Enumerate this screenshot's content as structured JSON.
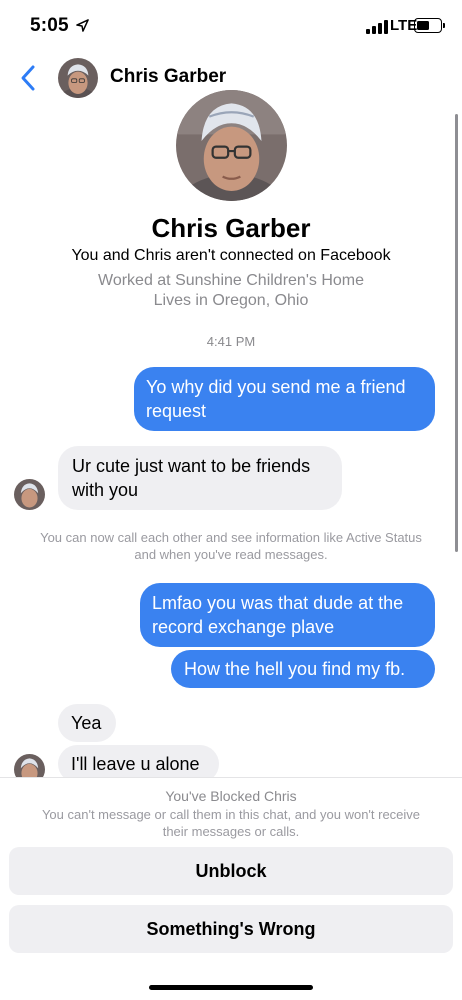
{
  "status_bar": {
    "time": "5:05",
    "network": "LTE",
    "battery_level": 0.55
  },
  "header": {
    "name": "Chris Garber"
  },
  "profile": {
    "name": "Chris Garber",
    "connection": "You and Chris aren't connected on Facebook",
    "work": "Worked at Sunshine Children's Home",
    "location": "Lives in Oregon, Ohio"
  },
  "conversation": {
    "timestamp": "4:41 PM",
    "messages": [
      {
        "direction": "outgoing",
        "text": "Yo why did you send me a friend request"
      },
      {
        "direction": "incoming",
        "text": "Ur cute just want to be friends with you"
      },
      {
        "direction": "outgoing",
        "text": "Lmfao you was that dude at the record exchange plave"
      },
      {
        "direction": "outgoing",
        "text": "How the hell you find my fb."
      },
      {
        "direction": "incoming",
        "text": "Yea"
      },
      {
        "direction": "incoming",
        "text": "I'll leave u alone"
      }
    ],
    "system_notice": "You can now call each other and see information like Active Status and when you've read messages."
  },
  "blocked": {
    "title": "You've Blocked Chris",
    "description": "You can't message or call them in this chat, and you won't receive their messages or calls.",
    "unblock_label": "Unblock",
    "wrong_label": "Something's Wrong"
  },
  "colors": {
    "outgoing_bubble": "#3a82f0",
    "incoming_bubble": "#efeff2",
    "accent": "#2d7cf6"
  }
}
